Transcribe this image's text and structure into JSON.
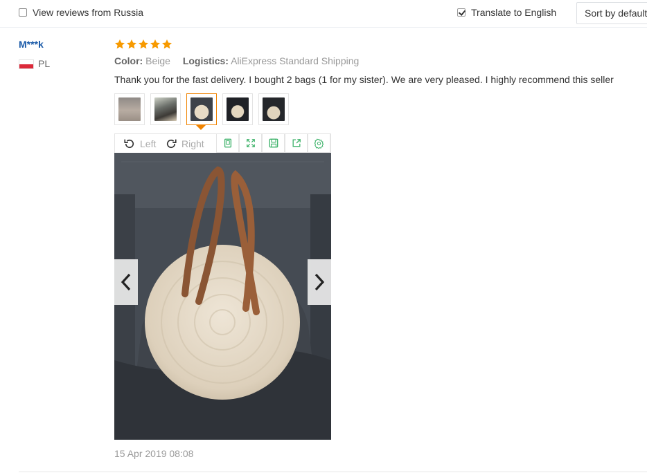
{
  "filters": {
    "russia_label": "View reviews from Russia",
    "russia_checked": false,
    "translate_label": "Translate to English",
    "translate_checked": true,
    "sort_value": "Sort by default"
  },
  "review": {
    "user": "M***k",
    "country": "PL",
    "rating": 5,
    "color_key": "Color:",
    "color_value": "Beige",
    "logistics_key": "Logistics:",
    "logistics_value": "AliExpress Standard Shipping",
    "text": "Thank you for the fast delivery. I bought 2 bags (1 for my sister). We are very pleased. I highly recommend this seller",
    "date": "15 Apr 2019 08:08",
    "thumbnails": [
      {
        "name": "photo-1"
      },
      {
        "name": "photo-2"
      },
      {
        "name": "photo-3",
        "active": true
      },
      {
        "name": "photo-4"
      },
      {
        "name": "photo-5"
      }
    ]
  },
  "viewer": {
    "rotate_left_label": "Left",
    "rotate_right_label": "Right",
    "tools": [
      "fit-screen-icon",
      "fullscreen-icon",
      "save-icon",
      "share-icon",
      "settings-icon"
    ],
    "prev_icon": "chevron-left-icon",
    "next_icon": "chevron-right-icon"
  },
  "colors": {
    "star": "#f79a00",
    "user_link": "#1a5aa8",
    "active_thumb": "#f08300",
    "tool_icon": "#3fb36b"
  }
}
